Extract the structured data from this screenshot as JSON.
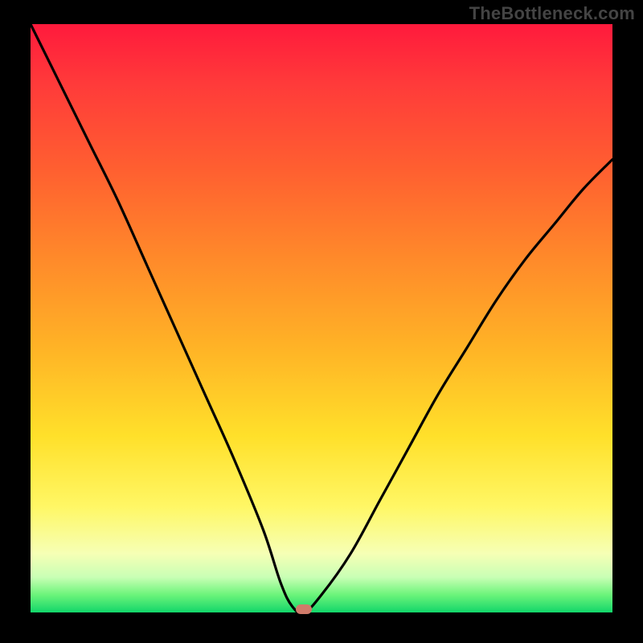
{
  "watermark_text": "TheBottleneck.com",
  "chart_data": {
    "type": "line",
    "title": "",
    "xlabel": "",
    "ylabel": "",
    "xlim": [
      0,
      100
    ],
    "ylim": [
      0,
      100
    ],
    "grid": false,
    "legend": false,
    "background_gradient": {
      "direction": "vertical",
      "stops": [
        {
          "pos": 0.0,
          "color": "#ff1a3c"
        },
        {
          "pos": 0.4,
          "color": "#ff8a2a"
        },
        {
          "pos": 0.7,
          "color": "#ffe02a"
        },
        {
          "pos": 0.9,
          "color": "#f6ffb5"
        },
        {
          "pos": 1.0,
          "color": "#12d66a"
        }
      ]
    },
    "series": [
      {
        "name": "bottleneck-curve",
        "color": "#000000",
        "x": [
          0,
          5,
          10,
          15,
          20,
          25,
          30,
          35,
          40,
          43,
          45,
          47,
          50,
          55,
          60,
          65,
          70,
          75,
          80,
          85,
          90,
          95,
          100
        ],
        "y": [
          100,
          90,
          80,
          70,
          59,
          48,
          37,
          26,
          14,
          5,
          1,
          0,
          3,
          10,
          19,
          28,
          37,
          45,
          53,
          60,
          66,
          72,
          77
        ]
      }
    ],
    "marker": {
      "name": "optimal-point",
      "x": 47,
      "y": 0.5,
      "color": "#d07b6a",
      "shape": "pill"
    }
  }
}
